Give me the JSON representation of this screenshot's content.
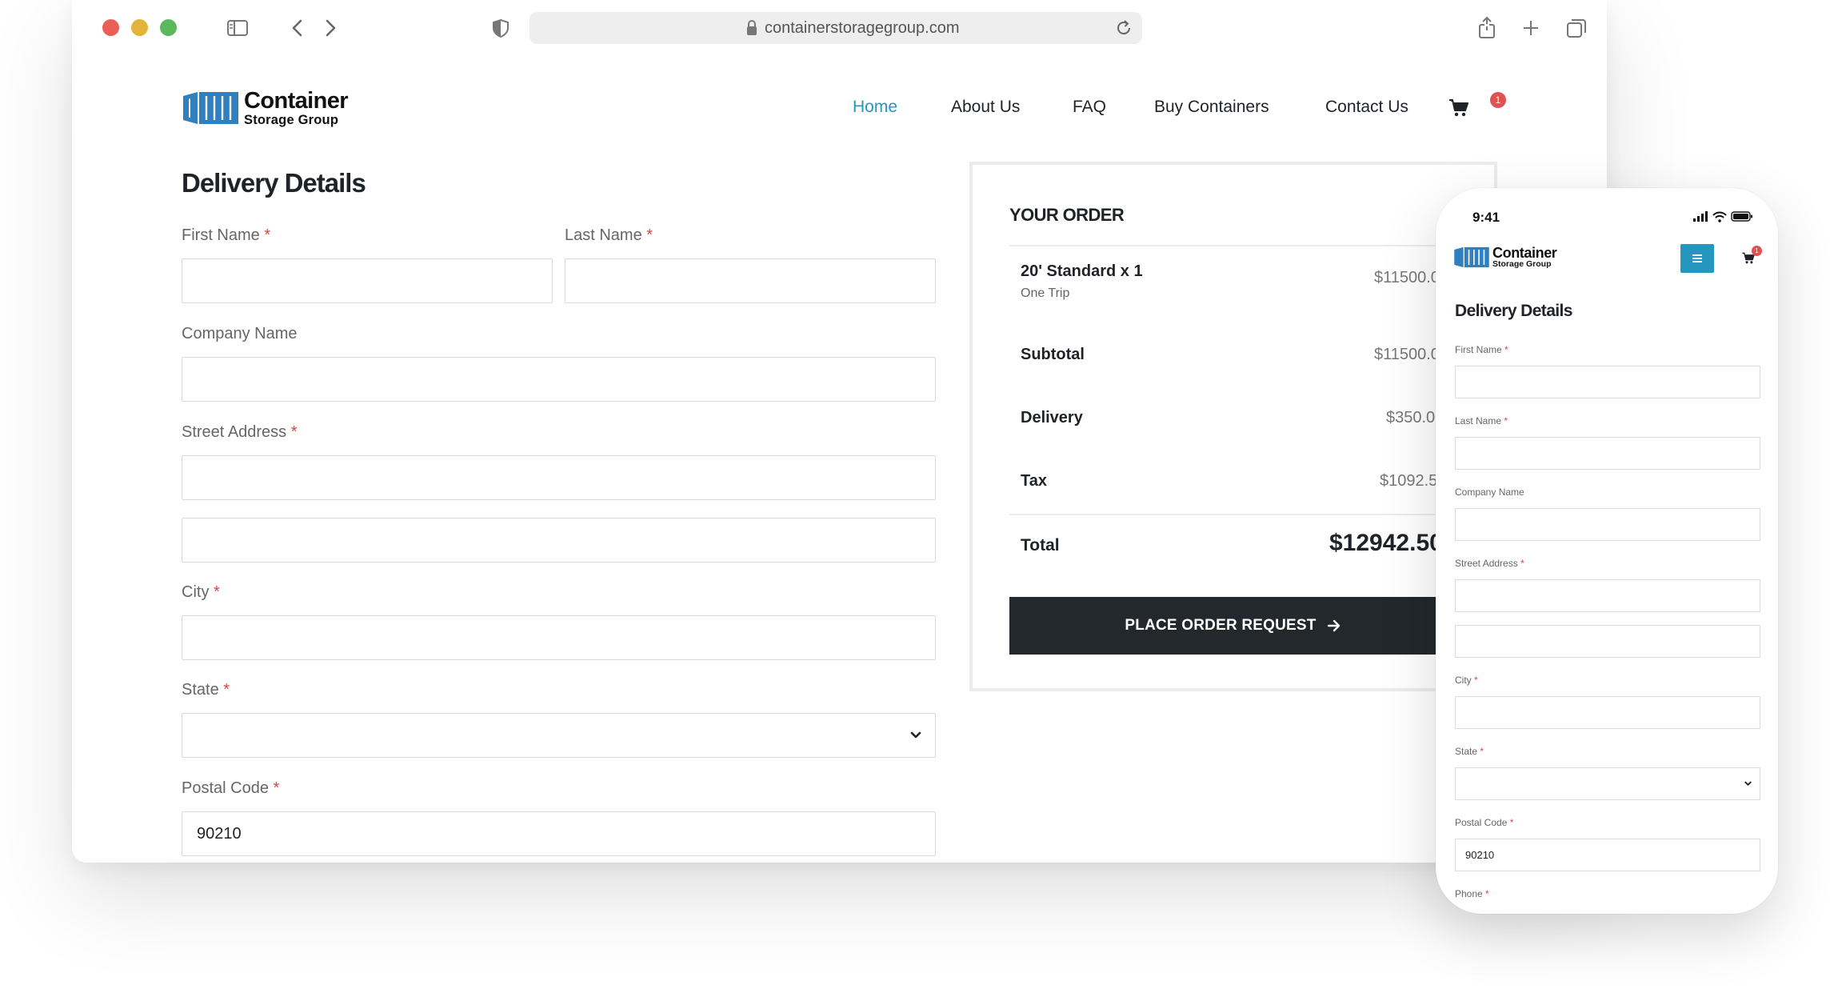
{
  "browser": {
    "url": "containerstoragegroup.com"
  },
  "site": {
    "logo": {
      "line1": "Container",
      "line2": "Storage Group"
    },
    "nav": [
      {
        "label": "Home",
        "active": true
      },
      {
        "label": "About Us"
      },
      {
        "label": "FAQ"
      },
      {
        "label": "Buy Containers"
      },
      {
        "label": "Contact Us"
      }
    ],
    "cart_count": "1"
  },
  "form": {
    "heading": "Delivery Details",
    "required_mark": "*",
    "first_name": {
      "label": "First Name",
      "value": ""
    },
    "last_name": {
      "label": "Last Name",
      "value": ""
    },
    "company_name": {
      "label": "Company Name",
      "value": ""
    },
    "street_address": {
      "label": "Street Address",
      "line1": "",
      "line2": ""
    },
    "city": {
      "label": "City",
      "value": ""
    },
    "state": {
      "label": "State",
      "value": ""
    },
    "postal_code": {
      "label": "Postal Code",
      "value": "90210"
    },
    "phone": {
      "label": "Phone"
    }
  },
  "order": {
    "title": "YOUR ORDER",
    "item": {
      "name": "20' Standard x 1",
      "sub": "One Trip",
      "price": "$11500.00"
    },
    "subtotal": {
      "label": "Subtotal",
      "value": "$11500.00"
    },
    "delivery": {
      "label": "Delivery",
      "value": "$350.00"
    },
    "tax": {
      "label": "Tax",
      "value": "$1092.50"
    },
    "total": {
      "label": "Total",
      "value": "$12942.50"
    },
    "button": "PLACE ORDER REQUEST"
  },
  "phone": {
    "time": "9:41"
  },
  "colors": {
    "accent": "#2596be",
    "button_dark": "#23282d",
    "badge": "#e05252",
    "required": "#d64545"
  }
}
